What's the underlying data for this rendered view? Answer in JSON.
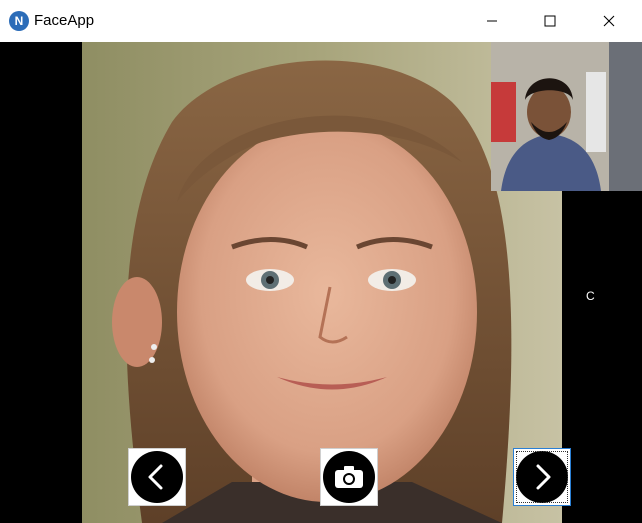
{
  "window": {
    "title": "FaceApp",
    "icon_letter": "N",
    "controls": [
      "minimize-icon",
      "maximize-icon",
      "close-icon"
    ]
  },
  "side_label": "C",
  "buttons": {
    "previous": {
      "icon": "chevron-left-icon"
    },
    "capture": {
      "icon": "camera-icon"
    },
    "next": {
      "icon": "chevron-right-icon",
      "focused": true
    }
  },
  "colors": {
    "titlebar": "#ffffff",
    "background": "#000000",
    "button_circle": "#000000",
    "focus_border": "#2a7fd4"
  }
}
